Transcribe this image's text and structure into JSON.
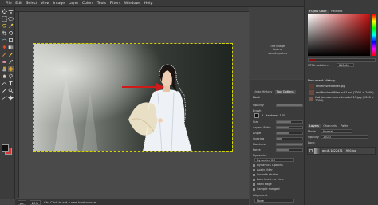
{
  "menubar": {
    "items": [
      "File",
      "Edit",
      "Select",
      "View",
      "Image",
      "Layer",
      "Colors",
      "Tools",
      "Filters",
      "Windows",
      "Help"
    ]
  },
  "canvas": {
    "arrow_color": "#d11a1a",
    "selection_color": "#d4d400"
  },
  "status": {
    "zoom": "20%",
    "unit": "px",
    "message": "Ctrl-Click to set a new heal source"
  },
  "tool_options": {
    "tabs": [
      "Undo History",
      "Tool Options"
    ],
    "title": "Heal",
    "opacity_label": "Opacity",
    "brush_label": "Brush",
    "brush_name": "2. Hardness 100",
    "size_label": "Size",
    "aspect_label": "Aspect Ratio",
    "angle_label": "Angle",
    "spacing_label": "Spacing",
    "hardness_label": "Hardness",
    "force_label": "Force",
    "dynamics_label": "Dynamics",
    "dynamics_value": "Dynamics Off",
    "dynamics_options": "Dynamics Options",
    "apply_jitter": "Apply Jitter",
    "smooth_stroke": "Smooth stroke",
    "lock_brush": "Lock brush to view",
    "hard_edge": "Hard edge",
    "sample_merged": "Sample merged",
    "alignment_label": "Alignment",
    "alignment_value": "None",
    "levels": {
      "opacity": 1.0,
      "size": 0.55,
      "aspect": 0.5,
      "angle": 0.5,
      "spacing": 0.2,
      "hardness": 1.0,
      "force": 0.5
    }
  },
  "right": {
    "fg_bg_tabs": [
      "FG/BG Color",
      "Palettes"
    ],
    "hex_label": "HTML notation:",
    "hex_value": "8d0a0a",
    "doc_history_title": "Document History",
    "history": [
      "red-finished-filter.jpg",
      "red-finished-filter.xcf-1.xcf (2000 × 2000)",
      "fashion-woman-red-model-19.jpg (2000 × 2000)"
    ],
    "layers_tabs": [
      "Layers",
      "Channels",
      "Paths"
    ],
    "mode_label": "Mode",
    "mode_value": "Normal",
    "opacity_label": "Opacity",
    "opacity_value": "100.0",
    "lock_label": "Lock:",
    "layer_name": "adult-1822431_1920.jpg",
    "preview_text": "The image\nhas no\nsample points"
  },
  "colors": {
    "foreground": "#111111",
    "background": "#d23a3a"
  }
}
